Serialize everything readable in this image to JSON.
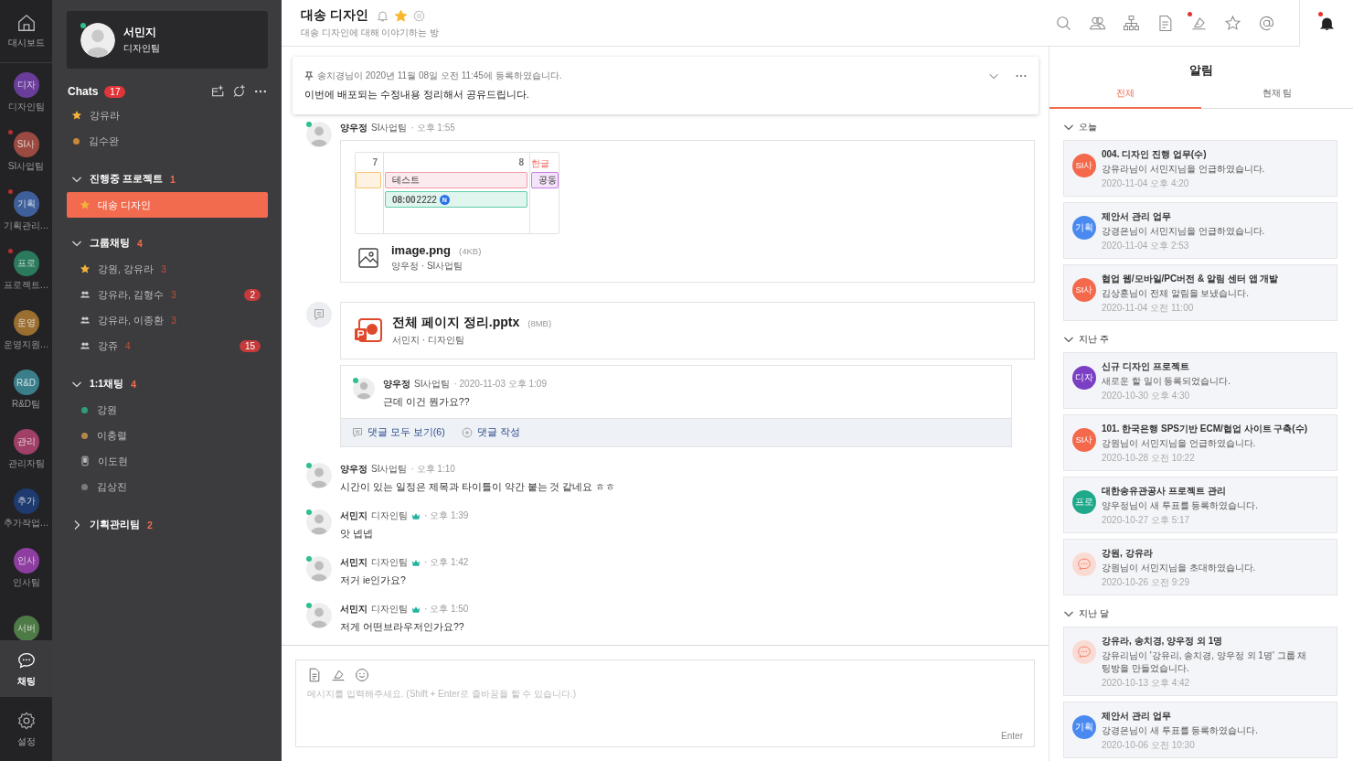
{
  "rail": {
    "home": {
      "label": "대시보드"
    },
    "teams": [
      {
        "abbr": "디자",
        "label": "디자인팀",
        "color": "#6a3d9a",
        "unread": false
      },
      {
        "abbr": "SI사",
        "label": "SI사업팀",
        "color": "#9a4a40",
        "unread": true
      },
      {
        "abbr": "기획",
        "label": "기획관리…",
        "color": "#3f5f9a",
        "unread": true
      },
      {
        "abbr": "프로",
        "label": "프로젝트…",
        "color": "#2c7a5e",
        "unread": true
      },
      {
        "abbr": "운영",
        "label": "운영지원…",
        "color": "#9a6d30",
        "unread": false
      },
      {
        "abbr": "R&D",
        "label": "R&D팀",
        "color": "#3a7e8a",
        "unread": false
      },
      {
        "abbr": "관리",
        "label": "관리자팀",
        "color": "#a04068",
        "unread": false
      },
      {
        "abbr": "추가",
        "label": "추가작업…",
        "color": "#1e3a6e",
        "unread": false
      },
      {
        "abbr": "인사",
        "label": "인사팀",
        "color": "#8e3ea0",
        "unread": false
      },
      {
        "abbr": "서버",
        "color": "#4e7a45",
        "unread": false
      }
    ],
    "bottom": [
      {
        "kind": "chat",
        "label": "채팅",
        "selected": true
      },
      {
        "kind": "settings",
        "label": "설정",
        "selected": false
      }
    ]
  },
  "profile": {
    "name": "서민지",
    "team": "디자인팀",
    "online": true
  },
  "chats": {
    "title": "Chats",
    "count": "17"
  },
  "favorites": [
    {
      "name": "강유라",
      "kind": "star",
      "selected": false
    },
    {
      "name": "김수완",
      "kind": "dot",
      "color": "#c8873a",
      "selected": false
    }
  ],
  "groups": [
    {
      "title": "진행중 프로젝트",
      "count": "1",
      "expanded": true,
      "items": [
        {
          "name": "대송 디자인",
          "kind": "star",
          "selected": true
        }
      ]
    },
    {
      "title": "그룹채팅",
      "count": "4",
      "expanded": true,
      "items": [
        {
          "name": "강원, 강유라",
          "kind": "star",
          "members": "3",
          "selected": false
        },
        {
          "name": "강유라, 김형수",
          "kind": "group",
          "members": "3",
          "badge": "2",
          "selected": false
        },
        {
          "name": "강유라, 이종환",
          "kind": "group",
          "members": "3",
          "selected": false
        },
        {
          "name": "강쥬",
          "kind": "group",
          "members": "4",
          "badge": "15",
          "selected": false
        }
      ]
    },
    {
      "title": "1:1채팅",
      "count": "4",
      "expanded": true,
      "items": [
        {
          "name": "강원",
          "kind": "dot",
          "color": "#2f9e77",
          "selected": false
        },
        {
          "name": "이충렬",
          "kind": "dot",
          "color": "#b5874a",
          "selected": false
        },
        {
          "name": "이도현",
          "kind": "mobile",
          "selected": false
        },
        {
          "name": "김상진",
          "kind": "dot",
          "color": "#7a7a7a",
          "selected": false
        }
      ]
    },
    {
      "title": "기획관리팀",
      "count": "2",
      "expanded": false
    }
  ],
  "room": {
    "title": "대송 디자인",
    "subtitle": "대송 디자인에 대해 이야기하는 방",
    "favorite": true
  },
  "toolbar": [
    {
      "kind": "search",
      "unread": false
    },
    {
      "kind": "people",
      "unread": false
    },
    {
      "kind": "org",
      "unread": false
    },
    {
      "kind": "doc",
      "unread": false
    },
    {
      "kind": "board",
      "unread": true
    },
    {
      "kind": "star",
      "unread": false
    },
    {
      "kind": "at",
      "unread": false
    }
  ],
  "alarm_tab": {
    "unread": true
  },
  "notice": {
    "meta": "송치경님이 2020년 11월 08일 오전 11:45에 등록하였습니다.",
    "text": "이번에 배포되는 수정내용 정리해서 공유드립니다."
  },
  "messages": [
    {
      "kind": "image",
      "author": "양우정",
      "team": "SI사업팀",
      "time": "· 오후 1:55",
      "online": true,
      "crown": false,
      "preview": [
        {
          "label": "7",
          "holiday": false,
          "events": [
            {
              "color": "#f8c471"
            }
          ]
        },
        {
          "label": "8",
          "holiday": false,
          "events": [
            {
              "title": "테스트",
              "color": "#f29aa8"
            },
            {
              "time": "08:00",
              "title": "2222",
              "badge": "N",
              "color": "#5fcfa8"
            }
          ]
        },
        {
          "label": "한글",
          "holiday": true,
          "events": [
            {
              "title": "공동",
              "color": "#c77ae0"
            }
          ]
        }
      ],
      "file": {
        "name": "image.png",
        "size": "(4KB)",
        "meta": "양우정 · SI사업팀"
      }
    },
    {
      "kind": "file",
      "file": {
        "name": "전체 페이지 정리.pptx",
        "size": "(8MB)",
        "meta": "서민지 · 디자인팀"
      },
      "comment": {
        "author": "양우정",
        "team": "SI사업팀",
        "time": "· 2020-11-03 오후 1:09",
        "text": "근데 이건 뭔가요??",
        "online": true
      },
      "actions": [
        {
          "kind": "list",
          "label": "댓글 모두 보기(6)"
        },
        {
          "kind": "add",
          "label": "댓글 작성"
        }
      ]
    },
    {
      "kind": "text",
      "author": "양우정",
      "team": "SI사업팀",
      "time": "· 오후 1:10",
      "online": true,
      "crown": false,
      "text": "시간이 있는 일정은 제목과 타이틀이 약간 붙는 것 같네요 ㅎㅎ"
    },
    {
      "kind": "text",
      "author": "서민지",
      "team": "디자인팀",
      "time": "· 오후 1:39",
      "online": true,
      "crown": true,
      "text": "앗 넵넵"
    },
    {
      "kind": "text",
      "author": "서민지",
      "team": "디자인팀",
      "time": "· 오후 1:42",
      "online": true,
      "crown": true,
      "text": "저거 ie인가요?"
    },
    {
      "kind": "text",
      "author": "서민지",
      "team": "디자인팀",
      "time": "· 오후 1:50",
      "online": true,
      "crown": true,
      "text": "저게 어떤브라우저인가요??"
    }
  ],
  "composer": {
    "placeholder": "메시지를 입력해주세요. (Shift + Enter로 줄바꿈을 할 수 있습니다.)",
    "send": "Enter"
  },
  "alarms": {
    "title": "알림",
    "tabs": [
      {
        "label": "전체",
        "selected": true
      },
      {
        "label": "현재 팀",
        "selected": false
      }
    ],
    "sections": [
      {
        "title": "오늘",
        "items": [
          {
            "kind": "team",
            "badge": "SI사",
            "color": "#f4684c",
            "title": "004. 디자인 진행 업무(수)",
            "body": "강유라님이 서민지님을 언급하였습니다.",
            "time": "2020-11-04 오후 4:20"
          },
          {
            "kind": "team",
            "badge": "기획",
            "color": "#4a8af0",
            "title": "제안서 관리 업무",
            "body": "강경은님이 서민지님을 언급하였습니다.",
            "time": "2020-11-04 오후 2:53"
          },
          {
            "kind": "team",
            "badge": "SI사",
            "color": "#f4684c",
            "title": "협업 웹/모바일/PC버전 & 알림 센터 앱 개발",
            "body": "김상훈님이 전체 알림을 보냈습니다.",
            "time": "2020-11-04 오전 11:00"
          }
        ]
      },
      {
        "title": "지난 주",
        "items": [
          {
            "kind": "team",
            "badge": "디자",
            "color": "#7b3fc4",
            "title": "신규 디자인 프로젝트",
            "body": "새로운 할 일이 등록되었습니다.",
            "time": "2020-10-30 오후 4:30"
          },
          {
            "kind": "team",
            "badge": "SI사",
            "color": "#f4684c",
            "title": "101. 한국은행 SPS기반 ECM/협업 사이트 구축(수)",
            "body": "강원님이 서민지님을 언급하였습니다.",
            "time": "2020-10-28 오전 10:22"
          },
          {
            "kind": "team",
            "badge": "프로",
            "color": "#1fa98a",
            "title": "대한송유관공사 프로젝트 관리",
            "body": "양우정님이 새 투표를 등록하였습니다.",
            "time": "2020-10-27 오후 5:17"
          },
          {
            "kind": "chat",
            "title": "강원, 강유라",
            "body": "강원님이 서민지님을 초대하였습니다.",
            "time": "2020-10-26 오전 9:29"
          }
        ]
      },
      {
        "title": "지난 달",
        "items": [
          {
            "kind": "chat",
            "title": "강유라, 송치경, 양우정 외 1명",
            "body": "강유리님이 '강유리, 송치경, 양우정 외 1명' 그룹 채팅방을 만들었습니다.",
            "time": "2020-10-13 오후 4:42"
          },
          {
            "kind": "team",
            "badge": "기획",
            "color": "#4a8af0",
            "title": "제안서 관리 업무",
            "body": "강경은님이 새 투표를 등록하였습니다.",
            "time": "2020-10-06 오전 10:30"
          }
        ]
      }
    ]
  }
}
